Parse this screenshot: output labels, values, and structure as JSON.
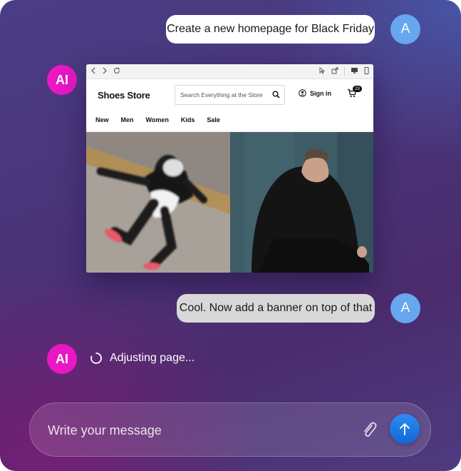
{
  "messages": {
    "user_avatar": "A",
    "ai_avatar": "AI",
    "first": "Create a new homepage for Black Friday",
    "second": "Cool. Now add a banner on top of that",
    "status": "Adjusting page..."
  },
  "preview": {
    "browser_icons": [
      "chevron-left-icon",
      "chevron-right-icon",
      "refresh-icon",
      "cursor-icon",
      "external-link-icon",
      "monitor-icon",
      "mobile-icon"
    ],
    "site_title": "Shoes Store",
    "search_placeholder": "Search Everything at the Store",
    "sign_in": "Sign in",
    "cart_count": "23",
    "nav": [
      "New",
      "Men",
      "Women",
      "Kids",
      "Sale"
    ],
    "hero_images": [
      "runner-photo",
      "model-photo"
    ]
  },
  "composer": {
    "placeholder": "Write your message"
  },
  "colors": {
    "user_avatar": "#67a7ee",
    "ai_avatar": "#ea17c4",
    "send_button": "#1a73e8"
  }
}
